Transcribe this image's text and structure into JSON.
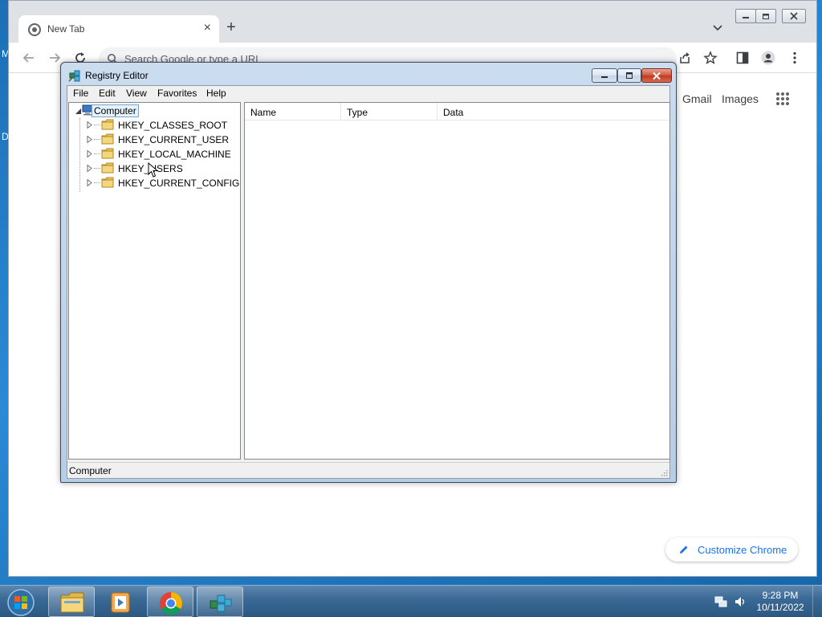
{
  "desktop": {
    "letter_top": "M",
    "letter_mid": "D"
  },
  "chrome": {
    "tab_title": "New Tab",
    "omnibox_placeholder": "Search Google or type a URL",
    "links": {
      "gmail": "Gmail",
      "images": "Images"
    },
    "customize_label": "Customize Chrome"
  },
  "regedit": {
    "title": "Registry Editor",
    "menu": [
      "File",
      "Edit",
      "View",
      "Favorites",
      "Help"
    ],
    "tree": {
      "root": "Computer",
      "hives": [
        "HKEY_CLASSES_ROOT",
        "HKEY_CURRENT_USER",
        "HKEY_LOCAL_MACHINE",
        "HKEY_USERS",
        "HKEY_CURRENT_CONFIG"
      ]
    },
    "columns": [
      "Name",
      "Type",
      "Data"
    ],
    "status": "Computer"
  },
  "taskbar": {
    "time": "9:28 PM",
    "date": "10/11/2022"
  },
  "colors": {
    "chrome_accent": "#1a73e8",
    "win7_taskbar": "#3b6a96",
    "regedit_frame": "#b8cde6",
    "selection_bg": "#e5f3fb"
  }
}
